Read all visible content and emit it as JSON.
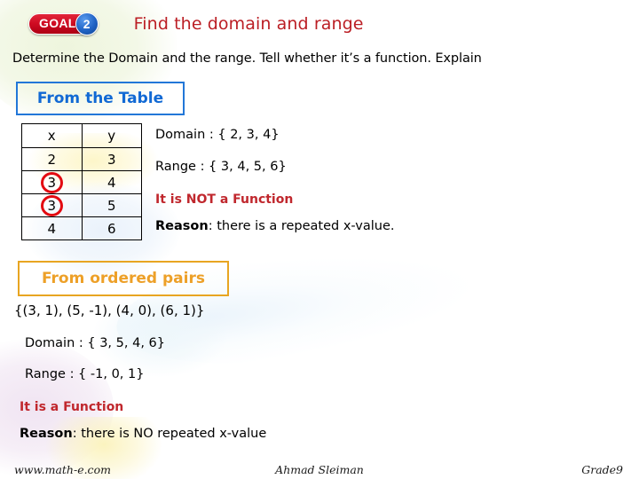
{
  "header": {
    "goal_label": "GOAL",
    "goal_number": "2",
    "title": "Find the domain and range",
    "title_color": "#bb1e24"
  },
  "instruction": "Determine the Domain and the range. Tell whether it’s a function. Explain",
  "sections": {
    "table": {
      "heading": "From the Table",
      "heading_color": "#1169d4",
      "border_color": "#2277d8"
    },
    "ordered_pairs": {
      "heading": "From ordered pairs",
      "heading_color": "#eda028",
      "border_color": "#e8a521"
    }
  },
  "table": {
    "headers": [
      "x",
      "y"
    ],
    "header_x_bg": "#fac96b",
    "header_x_color": "#cc1f00",
    "header_y_bg": "#0a5fe8",
    "header_y_color": "#ffffff",
    "circle_color": "#e30a11",
    "rows": [
      {
        "x": "2",
        "y": "3",
        "x_circled": false
      },
      {
        "x": "3",
        "y": "4",
        "x_circled": true
      },
      {
        "x": "3",
        "y": "5",
        "x_circled": true
      },
      {
        "x": "4",
        "y": "6",
        "x_circled": false
      }
    ]
  },
  "table_answers": {
    "domain": "Domain : { 2, 3, 4}",
    "range": "Range : { 3, 4, 5, 6}",
    "function_verdict": "It is NOT a Function",
    "verdict_color": "#c0272d",
    "reason_label": "Reason",
    "reason_text": ": there is a repeated x-value."
  },
  "pairs_answers": {
    "set": "{(3, 1), (5, -1), (4, 0), (6, 1)}",
    "domain": "Domain : { 3, 5, 4, 6}",
    "range": "Range : { -1, 0, 1}",
    "function_verdict": "It is a Function",
    "verdict_color": "#c0272d",
    "reason_label": "Reason",
    "reason_text": ": there is NO repeated x-value"
  },
  "footer": {
    "website": "www.math-e.com",
    "author": "Ahmad Sleiman",
    "grade": "Grade9"
  }
}
